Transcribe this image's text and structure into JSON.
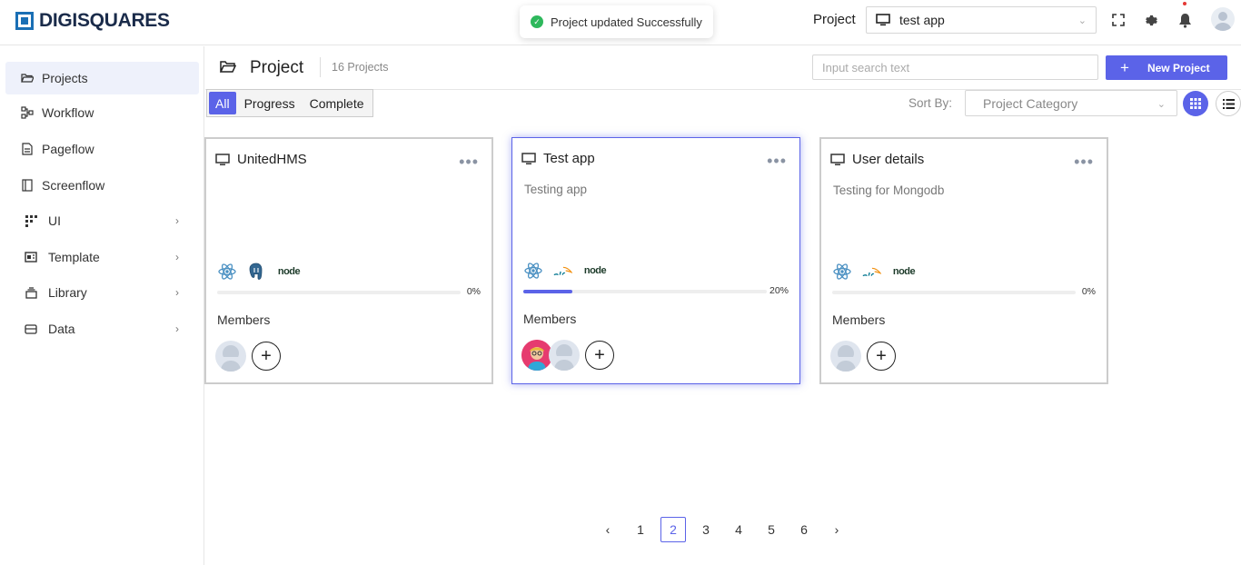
{
  "app": {
    "logo_text": "DIGISQUARES"
  },
  "toast": {
    "message": "Project updated Successfully"
  },
  "topbar": {
    "project_label": "Project",
    "project_selected": "test app"
  },
  "sidebar": {
    "items": [
      {
        "label": "Projects",
        "icon": "folder-open-icon"
      },
      {
        "label": "Workflow",
        "icon": "workflow-icon"
      },
      {
        "label": "Pageflow",
        "icon": "page-icon"
      },
      {
        "label": "Screenflow",
        "icon": "screen-icon"
      },
      {
        "label": "UI",
        "icon": "grid-icon"
      },
      {
        "label": "Template",
        "icon": "template-icon"
      },
      {
        "label": "Library",
        "icon": "library-icon"
      },
      {
        "label": "Data",
        "icon": "database-icon"
      }
    ]
  },
  "header": {
    "title": "Project",
    "count": "16 Projects",
    "search_placeholder": "Input search text",
    "new_button": "New Project"
  },
  "filters": {
    "tabs": [
      "All",
      "Progress",
      "Complete"
    ],
    "active": "All"
  },
  "sort": {
    "label": "Sort By:",
    "placeholder": "Project Category"
  },
  "cards": [
    {
      "title": "UnitedHMS",
      "description": "",
      "techs": [
        "react",
        "postgresql",
        "node"
      ],
      "progress_label": "0%",
      "progress": 0,
      "members_label": "Members"
    },
    {
      "title": "Test app",
      "description": "Testing app",
      "techs": [
        "react",
        "mysql",
        "node"
      ],
      "progress_label": "20%",
      "progress": 0.2,
      "members_label": "Members"
    },
    {
      "title": "User details",
      "description": "Testing for Mongodb",
      "techs": [
        "react",
        "mysql",
        "node"
      ],
      "progress_label": "0%",
      "progress": 0,
      "members_label": "Members"
    }
  ],
  "tech_labels": {
    "node": "node"
  },
  "pagination": {
    "pages": [
      "1",
      "2",
      "3",
      "4",
      "5",
      "6"
    ],
    "current": "2",
    "prev": "‹",
    "next": "›"
  },
  "colors": {
    "accent": "#5b63e8",
    "success": "#2eb85c",
    "brand": "#1a6fb5"
  }
}
